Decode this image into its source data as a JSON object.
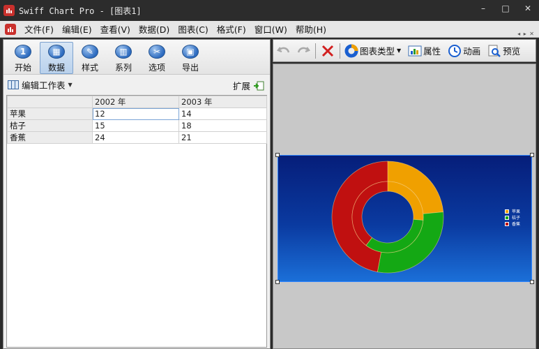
{
  "window": {
    "title": "Swiff Chart Pro - [图表1]",
    "minimize": "–",
    "maximize": "□",
    "close": "✕"
  },
  "menu": [
    "文件(F)",
    "编辑(E)",
    "查看(V)",
    "数据(D)",
    "图表(C)",
    "格式(F)",
    "窗口(W)",
    "帮助(H)"
  ],
  "left_toolbar": [
    {
      "label": "开始",
      "icon": "number-1-icon",
      "glyph": "1"
    },
    {
      "label": "数据",
      "icon": "table-icon",
      "glyph": "▦"
    },
    {
      "label": "样式",
      "icon": "brush-icon",
      "glyph": "✎"
    },
    {
      "label": "系列",
      "icon": "bar-series-icon",
      "glyph": "▥"
    },
    {
      "label": "选项",
      "icon": "tools-icon",
      "glyph": "✂"
    },
    {
      "label": "导出",
      "icon": "save-icon",
      "glyph": "▣"
    }
  ],
  "sheet": {
    "title": "编辑工作表",
    "expand_label": "扩展",
    "columns": [
      "",
      "2002 年",
      "2003 年"
    ],
    "rows": [
      {
        "name": "苹果",
        "v2002": "12",
        "v2003": "14"
      },
      {
        "name": "桔子",
        "v2002": "15",
        "v2003": "18"
      },
      {
        "name": "香蕉",
        "v2002": "24",
        "v2003": "21"
      }
    ]
  },
  "right_toolbar": {
    "chart_type_label": "图表类型",
    "properties_label": "属性",
    "animation_label": "动画",
    "preview_label": "预览"
  },
  "colors": {
    "apple": "#f0a000",
    "orange": "#14a814",
    "banana": "#c01010"
  },
  "chart_data": {
    "type": "pie",
    "style": "doughnut",
    "categories": [
      "苹果",
      "桔子",
      "香蕉"
    ],
    "series": [
      {
        "name": "2002 年",
        "values": [
          12,
          15,
          24
        ]
      },
      {
        "name": "2003 年",
        "values": [
          14,
          18,
          21
        ]
      }
    ],
    "legend": [
      "苹果",
      "桔子",
      "香蕉"
    ],
    "legend_position": "right"
  }
}
